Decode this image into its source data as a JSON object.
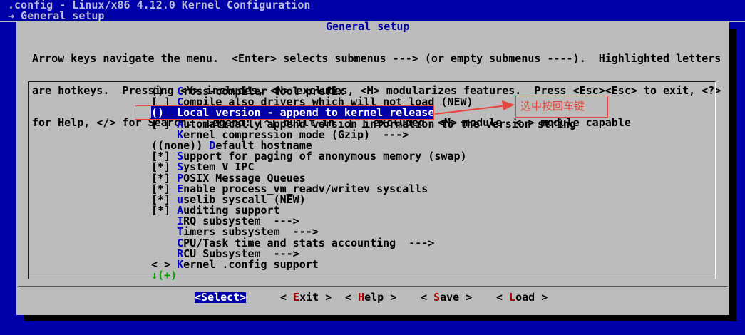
{
  "header": {
    "title": ".config - Linux/x86 4.12.0 Kernel Configuration",
    "breadcrumb": "→ General setup"
  },
  "dialog": {
    "title": "General setup",
    "help_lines": [
      "Arrow keys navigate the menu.  <Enter> selects submenus ---> (or empty submenus ----).  Highlighted letters",
      "are hotkeys.  Pressing <Y> includes, <N> excludes, <M> modularizes features.  Press <Esc><Esc> to exit, <?>",
      "for Help, </> for Search.  Legend: [*] built-in  [ ] excluded  <M> module  < > module capable"
    ]
  },
  "menu": {
    "items": [
      {
        "prefix": "()  ",
        "hotkey": "C",
        "rest": "ross-compiler tool prefix"
      },
      {
        "prefix": "[ ] ",
        "hotkey": "C",
        "rest": "ompile also drivers which will not load (NEW)"
      },
      {
        "prefix": "()  ",
        "hotkey": "L",
        "rest": "ocal version - append to kernel release",
        "selected": true
      },
      {
        "prefix": "[ ] ",
        "hotkey": "A",
        "rest": "utomatically append version information to the version string"
      },
      {
        "prefix": "    ",
        "hotkey": "K",
        "rest": "ernel compression mode (Gzip)  --->"
      },
      {
        "prefix": "((none)) ",
        "hotkey": "D",
        "rest": "efault hostname"
      },
      {
        "prefix": "[*] ",
        "hotkey": "S",
        "rest": "upport for paging of anonymous memory (swap)"
      },
      {
        "prefix": "[*] ",
        "hotkey": "S",
        "rest": "ystem V IPC"
      },
      {
        "prefix": "[*] ",
        "hotkey": "P",
        "rest": "OSIX Message Queues"
      },
      {
        "prefix": "[*] ",
        "hotkey": "E",
        "rest": "nable process_vm_readv/writev syscalls"
      },
      {
        "prefix": "[*] ",
        "hotkey": "u",
        "rest": "selib syscall (NEW)"
      },
      {
        "prefix": "[*] ",
        "hotkey": "A",
        "rest": "uditing support"
      },
      {
        "prefix": "    ",
        "hotkey": "I",
        "rest": "RQ subsystem  --->"
      },
      {
        "prefix": "    ",
        "hotkey": "T",
        "rest": "imers subsystem  --->"
      },
      {
        "prefix": "    ",
        "hotkey": "C",
        "rest": "PU/Task time and stats accounting  --->"
      },
      {
        "prefix": "    ",
        "hotkey": "R",
        "rest": "CU Subsystem  --->"
      },
      {
        "prefix": "< > ",
        "hotkey": "K",
        "rest": "ernel .config support"
      }
    ],
    "more_indicator": "↓(+)"
  },
  "buttons": [
    {
      "pre": "<",
      "key": "S",
      "post": "elect>",
      "active": true
    },
    {
      "pre": "< ",
      "key": "E",
      "post": "xit >",
      "active": false
    },
    {
      "pre": "< ",
      "key": "H",
      "post": "elp >",
      "active": false
    },
    {
      "pre": "< ",
      "key": "S",
      "post": "ave >",
      "active": false
    },
    {
      "pre": "< ",
      "key": "L",
      "post": "oad >",
      "active": false
    }
  ],
  "annotation": {
    "label": "选中按回车键",
    "color": "#e8453c"
  }
}
